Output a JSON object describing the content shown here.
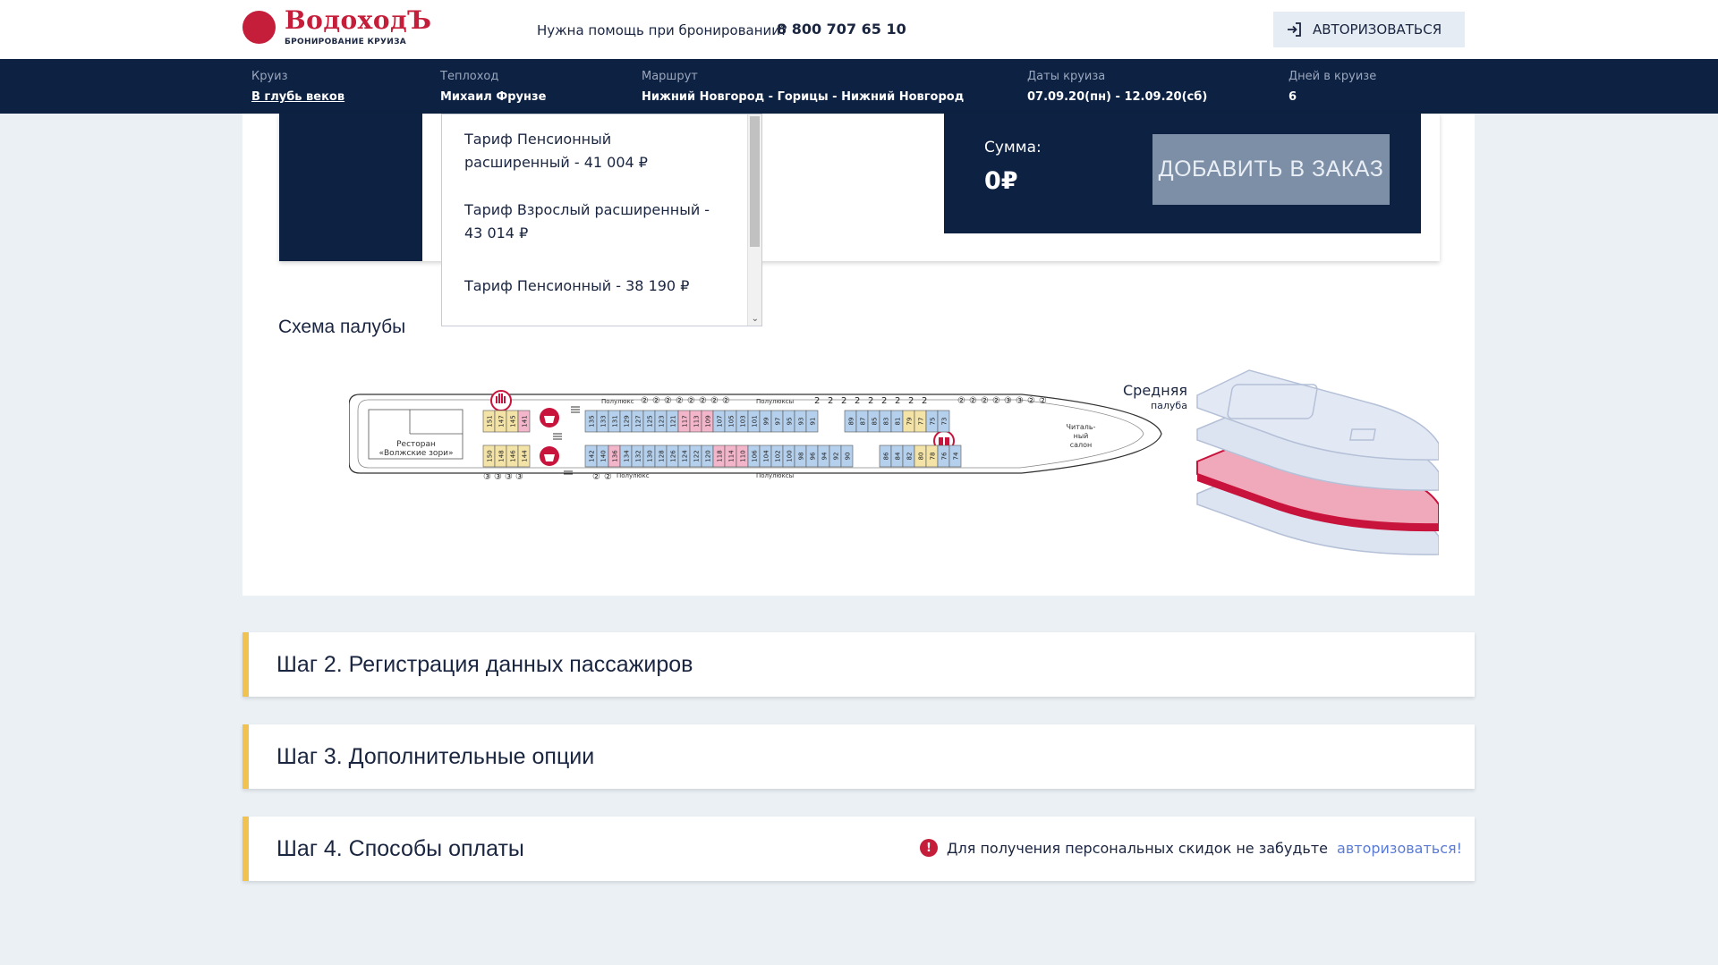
{
  "header": {
    "logo_name": "ВодоходЪ",
    "logo_sub": "БРОНИРОВАНИЕ КРУИЗА",
    "help_question": "Нужна помощь при бронировании?",
    "phone": "8 800 707 65 10",
    "auth_label": "АВТОРИЗОВАТЬСЯ"
  },
  "cruise_info": [
    {
      "label": "Круиз",
      "value": "В глубь веков"
    },
    {
      "label": "Теплоход",
      "value": "Михаил Фрунзе"
    },
    {
      "label": "Маршрут",
      "value": "Нижний Новгород - Горицы - Нижний Новгород"
    },
    {
      "label": "Даты круиза",
      "value": "07.09.20(пн) - 12.09.20(сб)"
    },
    {
      "label": "Дней в круизе",
      "value": "6"
    }
  ],
  "tariffs": [
    "Тариф Пенсионный расширенный - 41 004 ₽",
    "Тариф Взрослый расширенный - 43 014 ₽",
    "Тариф Пенсионный - 38 190 ₽"
  ],
  "summary": {
    "label": "Сумма:",
    "value": "0₽",
    "add_label": "ДОБАВИТЬ В ЗАКАЗ"
  },
  "deck": {
    "title": "Схема палубы",
    "name_line1": "Средняя",
    "name_line2": "палуба",
    "labels": {
      "polulux": "Полулюкс",
      "poluluxy": "Полулюксы",
      "restaurant_1": "Ресторан",
      "restaurant_2": "«Волжские зори»",
      "reading_1": "Читаль-",
      "reading_2": "ный",
      "reading_3": "салон"
    },
    "top_row": [
      "151",
      "147",
      "145",
      "141",
      "135",
      "133",
      "131",
      "129",
      "127",
      "125",
      "123",
      "121",
      "117",
      "113",
      "109",
      "107",
      "105",
      "103",
      "101",
      "99",
      "97",
      "95",
      "93",
      "91",
      "89",
      "87",
      "85",
      "83",
      "81",
      "79",
      "77",
      "75",
      "73"
    ],
    "bottom_row": [
      "150",
      "148",
      "146",
      "144",
      "142",
      "140",
      "136",
      "134",
      "132",
      "130",
      "128",
      "126",
      "124",
      "122",
      "120",
      "118",
      "114",
      "110",
      "106",
      "104",
      "102",
      "100",
      "98",
      "96",
      "94",
      "92",
      "90",
      "86",
      "84",
      "82",
      "80",
      "78",
      "76",
      "74"
    ],
    "top_badges": [
      "②",
      "②",
      "②",
      "②",
      "②",
      "②",
      "②",
      "②",
      "2",
      "2",
      "2",
      "2",
      "2",
      "2",
      "2",
      "2",
      "2",
      "②",
      "②",
      "②",
      "②",
      "③",
      "③",
      "②",
      "②"
    ],
    "bottom_badges": [
      "③",
      "③",
      "③",
      "③",
      "②",
      "②"
    ],
    "colors": {
      "yellow": "#f3e3a6",
      "blue": "#b5d0ec",
      "pink": "#f2b5c9",
      "white": "#ffffff",
      "highlight": "#c8143c"
    }
  },
  "steps": [
    {
      "title": "Шаг 2. Регистрация данных пассажиров"
    },
    {
      "title": "Шаг 3. Дополнительные опции"
    },
    {
      "title": "Шаг 4. Способы оплаты"
    }
  ],
  "notice": {
    "text": "Для получения персональных скидок не забудьте",
    "link": "авторизоваться!"
  }
}
